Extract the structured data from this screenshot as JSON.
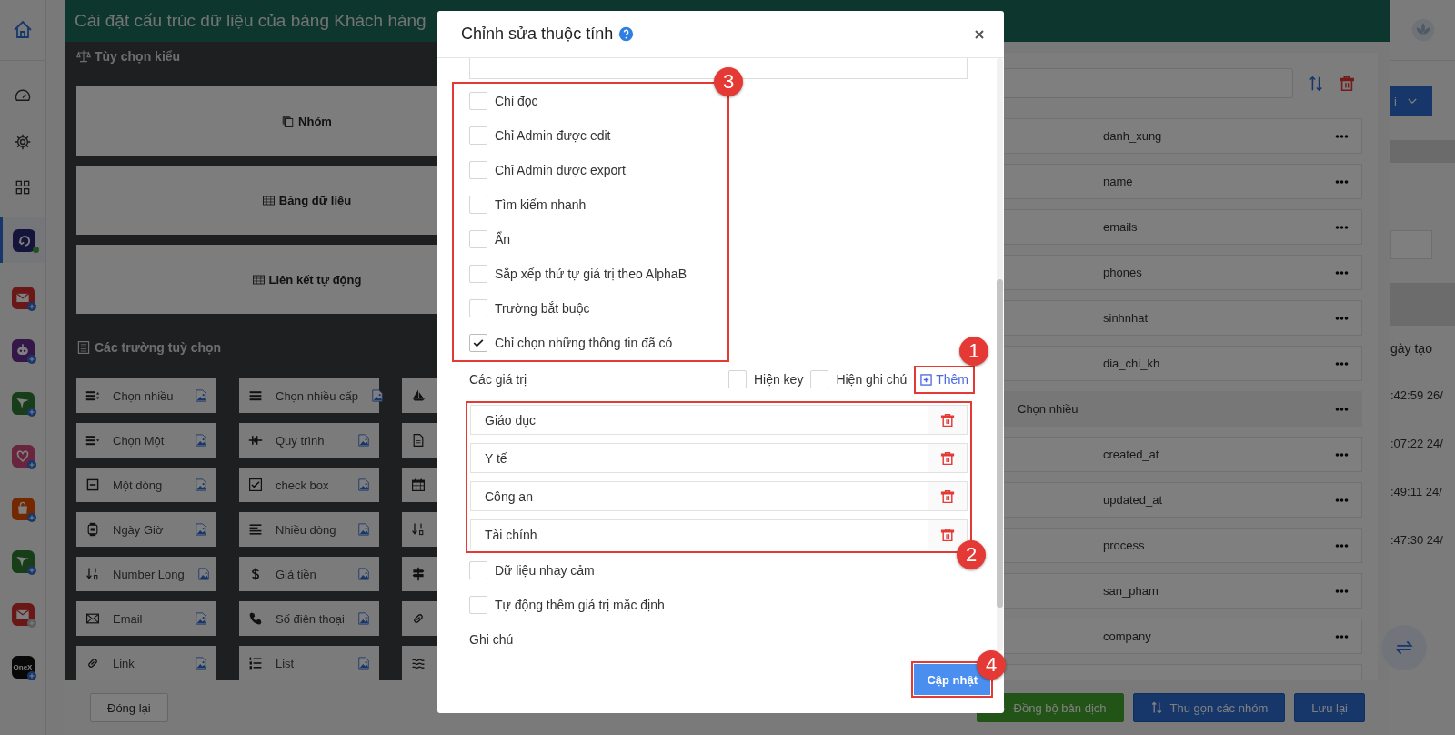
{
  "sidebar": {
    "items": [
      {
        "kind": "home",
        "selected": false
      },
      {
        "kind": "gauge",
        "selected": false
      },
      {
        "kind": "gear",
        "selected": false
      },
      {
        "kind": "grid",
        "selected": false
      },
      {
        "kind": "app-swirl",
        "selected": true,
        "online": true
      },
      {
        "kind": "app-mail",
        "selected": false,
        "online": false,
        "badge_active": true
      },
      {
        "kind": "app-robot",
        "selected": false,
        "online": false,
        "badge_active": true
      },
      {
        "kind": "app-plane",
        "selected": false,
        "online": false,
        "badge_active": true
      },
      {
        "kind": "app-heart",
        "selected": false,
        "online": false,
        "badge_active": true
      },
      {
        "kind": "app-bag",
        "selected": false,
        "online": false,
        "badge_active": true
      },
      {
        "kind": "app-plane",
        "selected": false,
        "online": false,
        "badge_active": true
      },
      {
        "kind": "app-mail",
        "selected": false,
        "online": false,
        "badge_active": false
      },
      {
        "kind": "app-text",
        "label": "OneX",
        "selected": false,
        "online": false,
        "badge_active": true
      }
    ]
  },
  "header": {
    "title": "Cài đặt cấu trúc dữ liệu của bảng Khách hàng"
  },
  "style_panel": {
    "title": "Tùy chọn kiểu",
    "tiles": [
      {
        "kind": "group",
        "label": "Nhóm"
      },
      {
        "kind": "table",
        "label": "Bảng dữ liệu"
      },
      {
        "kind": "table",
        "label": "Liên kết tự động"
      }
    ]
  },
  "fields_panel": {
    "title": "Các trường tuỳ chọn",
    "items": [
      {
        "kind": "multi-select",
        "label": "Chọn nhiều"
      },
      {
        "kind": "multi-level",
        "label": "Chọn nhiều cấp"
      },
      {
        "kind": "boat"
      },
      {
        "kind": "single-select",
        "label": "Chọn Một"
      },
      {
        "kind": "process",
        "label": "Quy trình"
      },
      {
        "kind": "document"
      },
      {
        "kind": "line",
        "label": "Một dòng"
      },
      {
        "kind": "checkbox",
        "label": "check box"
      },
      {
        "kind": "calendar"
      },
      {
        "kind": "datetime",
        "label": "Ngày Giờ"
      },
      {
        "kind": "multiline",
        "label": "Nhiều dòng"
      },
      {
        "kind": "number"
      },
      {
        "kind": "number",
        "label": "Number Long"
      },
      {
        "kind": "money",
        "label": "Giá tiền"
      },
      {
        "kind": "signpost"
      },
      {
        "kind": "email",
        "label": "Email"
      },
      {
        "kind": "phone",
        "label": "Số điện thoại"
      },
      {
        "kind": "link"
      },
      {
        "kind": "link",
        "label": "Link"
      },
      {
        "kind": "list",
        "label": "List"
      },
      {
        "kind": "wave"
      }
    ]
  },
  "field_list": {
    "items": [
      {
        "kind": "field",
        "label": "danh_xung"
      },
      {
        "kind": "field",
        "label": "name"
      },
      {
        "kind": "field",
        "label": "emails"
      },
      {
        "kind": "field",
        "label": "phones"
      },
      {
        "kind": "field",
        "label": "sinhnhat"
      },
      {
        "kind": "field",
        "label": "dia_chi_kh"
      },
      {
        "kind": "group",
        "label": "Chọn nhiều"
      },
      {
        "kind": "field",
        "label": "created_at"
      },
      {
        "kind": "field",
        "label": "updated_at"
      },
      {
        "kind": "field",
        "label": "process"
      },
      {
        "kind": "field",
        "label": "san_pham"
      },
      {
        "kind": "field",
        "label": "company"
      },
      {
        "kind": "field"
      }
    ]
  },
  "footer": {
    "buttons": [
      {
        "kind": "secondary",
        "label": "Đóng lại"
      },
      {
        "kind": "sync",
        "label": "Đồng bộ bản dịch"
      },
      {
        "kind": "collapse",
        "label": "Thu gọn các nhóm"
      },
      {
        "kind": "primary",
        "label": "Lưu lại"
      }
    ]
  },
  "background_page": {
    "button_label": "i",
    "column_header": "gày tạo",
    "times": [
      ":42:59 26/",
      ":07:22 24/",
      ":49:11 24/",
      ":47:30 24/"
    ]
  },
  "modal": {
    "title": "Chỉnh sửa thuộc tính",
    "options_callout": "3",
    "options": [
      {
        "label": "Chỉ đọc",
        "checked": false
      },
      {
        "label": "Chỉ Admin được edit",
        "checked": false
      },
      {
        "label": "Chỉ Admin được export",
        "checked": false
      },
      {
        "label": "Tìm kiếm nhanh",
        "checked": false
      },
      {
        "label": "Ẩn",
        "checked": false
      },
      {
        "label": "Sắp xếp thứ tự giá trị theo AlphaB",
        "checked": false
      },
      {
        "label": "Trường bắt buộc",
        "checked": false
      },
      {
        "label": "Chỉ chọn những thông tin đã có",
        "checked": true
      }
    ],
    "values_label": "Các giá trị",
    "toggles": [
      {
        "label": "Hiện key",
        "checked": false
      },
      {
        "label": "Hiện ghi chú",
        "checked": false
      }
    ],
    "add_link": "Thêm",
    "add_callout": "1",
    "values_callout": "2",
    "values": [
      "Giáo dục",
      "Y tế",
      "Công an",
      "Tài chính"
    ],
    "more_options": [
      {
        "label": "Dữ liệu nhạy cảm",
        "checked": false
      },
      {
        "label": "Tự động thêm giá trị mặc định",
        "checked": false
      }
    ],
    "note_label": "Ghi chú",
    "submit": "Cập nhật",
    "submit_callout": "4"
  }
}
